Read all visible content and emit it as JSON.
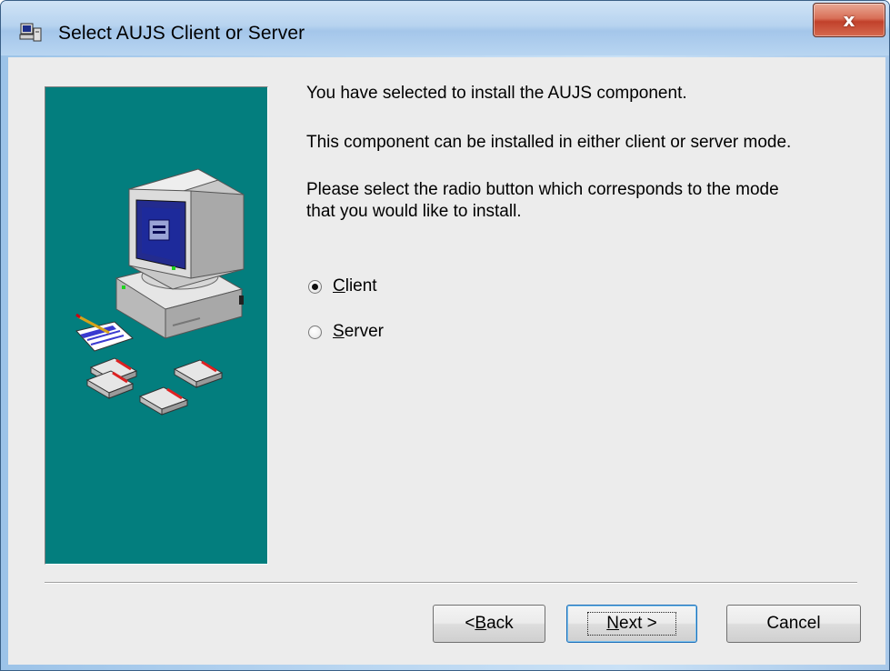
{
  "window": {
    "title": "Select AUJS Client or Server",
    "title_icon": "setup-computer-icon",
    "close_label": "x"
  },
  "content": {
    "line1": "You have selected to install the AUJS component.",
    "line2": "This component can be installed in either client or server mode.",
    "line3a": "Please select the radio button which corresponds to the mode",
    "line3b": "that you would like to install."
  },
  "radios": {
    "selected": "Client",
    "client": {
      "mnemonic": "C",
      "rest": "lient"
    },
    "server": {
      "mnemonic": "S",
      "rest": "erver"
    }
  },
  "buttons": {
    "back": {
      "prefix": "< ",
      "mnemonic": "B",
      "rest": "ack"
    },
    "next": {
      "mnemonic": "N",
      "rest": "ext >"
    },
    "cancel": "Cancel"
  },
  "colors": {
    "side_panel": "#037e7e",
    "dialog_bg": "#ececec",
    "close_button": "#c1412b"
  }
}
